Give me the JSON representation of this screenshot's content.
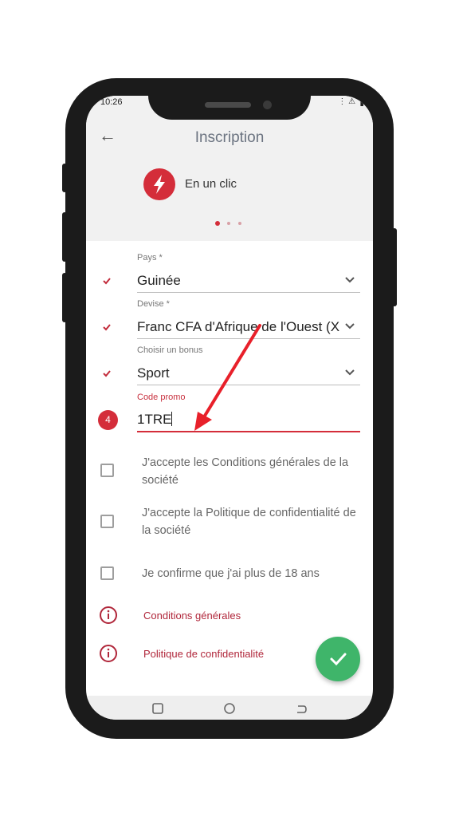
{
  "status_bar": {
    "time": "10:26",
    "icons": "⋮ ⚠ ▐"
  },
  "header": {
    "title": "Inscription",
    "back_icon": "back-arrow-icon"
  },
  "mode": {
    "label": "En un clic",
    "icon": "lightning-bolt-icon",
    "accent_color": "#d42d3a"
  },
  "pager": {
    "active_index": 0,
    "count": 3
  },
  "form": {
    "country": {
      "label": "Pays *",
      "value": "Guinée"
    },
    "currency": {
      "label": "Devise *",
      "value": "Franc CFA d'Afrique de l'Ouest (X"
    },
    "bonus": {
      "label": "Choisir un bonus",
      "value": "Sport"
    },
    "promo": {
      "label": "Code promo",
      "value": "1TRE",
      "step_number": "4"
    }
  },
  "checkboxes": [
    {
      "label": "J'accepte les Conditions générales de la société",
      "checked": false
    },
    {
      "label": "J'accepte la Politique de confidentialité de la société",
      "checked": false
    },
    {
      "label": "Je confirme que j'ai plus de 18 ans",
      "checked": false
    }
  ],
  "links": {
    "terms": "Conditions générales",
    "privacy": "Politique de confidentialité"
  },
  "colors": {
    "accent": "#d42d3a",
    "confirm": "#3fb56a",
    "link": "#b0263a"
  }
}
